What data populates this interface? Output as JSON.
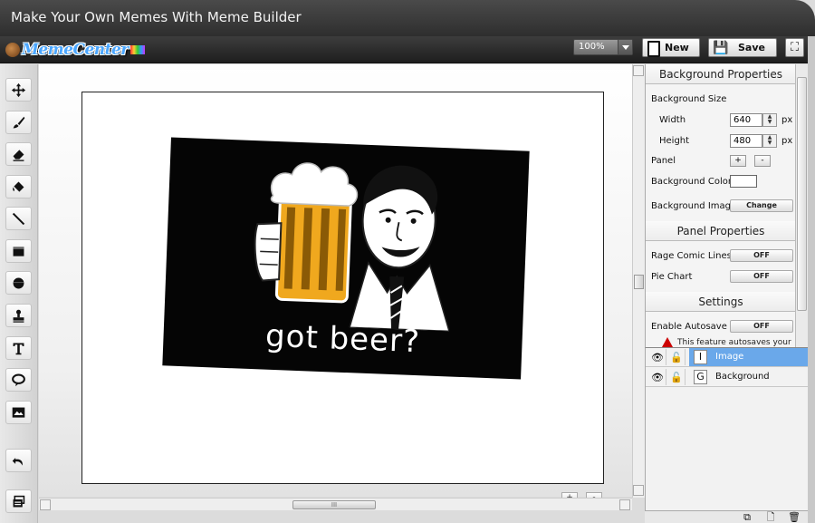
{
  "window": {
    "title": "Make Your Own Memes With Meme Builder"
  },
  "toolbar": {
    "logo_text": "MemeCenter",
    "zoom_value": "100%",
    "new_label": "New",
    "save_label": "Save"
  },
  "tools": [
    {
      "name": "move-tool",
      "icon": "move-arrows-icon"
    },
    {
      "name": "brush-tool",
      "icon": "brush-icon"
    },
    {
      "name": "eraser-tool",
      "icon": "eraser-icon"
    },
    {
      "name": "fill-tool",
      "icon": "paint-bucket-icon"
    },
    {
      "name": "line-tool",
      "icon": "line-icon"
    },
    {
      "name": "rectangle-tool",
      "icon": "rectangle-icon"
    },
    {
      "name": "ellipse-tool",
      "icon": "ellipse-icon"
    },
    {
      "name": "stamp-tool",
      "icon": "stamp-icon"
    },
    {
      "name": "text-tool",
      "icon": "text-icon"
    },
    {
      "name": "speech-bubble-tool",
      "icon": "speech-bubble-icon"
    },
    {
      "name": "image-tool",
      "icon": "image-icon"
    },
    {
      "name": "undo-tool",
      "icon": "undo-icon"
    },
    {
      "name": "layers-tool",
      "icon": "layers-icon"
    }
  ],
  "canvas": {
    "caption": "got beer?",
    "zoom_in_label": "+",
    "zoom_out_label": "-",
    "scroll_thumb_label": "III"
  },
  "properties": {
    "background_section": "Background Properties",
    "background_size_label": "Background Size",
    "width_label": "Width",
    "width_value": "640",
    "height_label": "Height",
    "height_value": "480",
    "unit": "px",
    "panel_label": "Panel",
    "panel_add": "+",
    "panel_remove": "-",
    "bg_color_label": "Background Color",
    "bg_color_value": "#ffffff",
    "bg_image_label": "Background Image",
    "change_label": "Change",
    "panel_section": "Panel Properties",
    "rage_lines_label": "Rage Comic Lines",
    "rage_lines_value": "OFF",
    "pie_chart_label": "Pie Chart",
    "pie_chart_value": "OFF",
    "settings_section": "Settings",
    "autosave_label": "Enable Autosave",
    "autosave_value": "OFF",
    "autosave_warning": "This feature autosaves your"
  },
  "layers": [
    {
      "badge": "I",
      "name": "Image",
      "selected": true
    },
    {
      "badge": "G",
      "name": "Background",
      "selected": false
    }
  ],
  "colors": {
    "titlebar": "#3a3a3a",
    "layer_selected": "#6aa8ea",
    "canvas_bg": "#ffffff",
    "meme_bg": "#050505",
    "beer": "#f0a81e"
  }
}
